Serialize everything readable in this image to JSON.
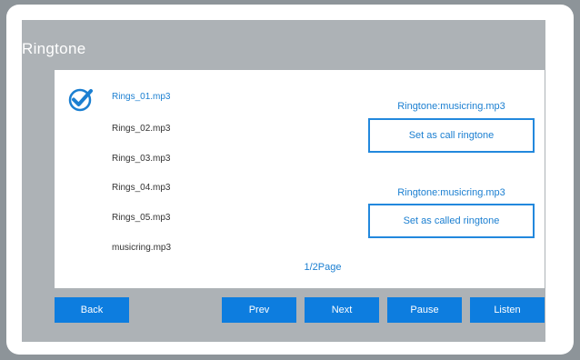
{
  "title": "Ringtone",
  "files": [
    {
      "name": "Rings_01.mp3",
      "selected": true
    },
    {
      "name": "Rings_02.mp3",
      "selected": false
    },
    {
      "name": "Rings_03.mp3",
      "selected": false
    },
    {
      "name": "Rings_04.mp3",
      "selected": false
    },
    {
      "name": "Rings_05.mp3",
      "selected": false
    },
    {
      "name": "musicring.mp3",
      "selected": false
    }
  ],
  "call_ringtone": {
    "label": "Ringtone:musicring.mp3",
    "button": "Set as call ringtone"
  },
  "called_ringtone": {
    "label": "Ringtone:musicring.mp3",
    "button": "Set as called ringtone"
  },
  "pagination": "1/2Page",
  "buttons": {
    "back": "Back",
    "prev": "Prev",
    "next": "Next",
    "pause": "Pause",
    "listen": "Listen"
  },
  "colors": {
    "accent": "#1b7fd1",
    "button_bg": "#0d7ddf",
    "frame_bg": "#adb2b6"
  },
  "icons": {
    "selected": "check-circle-icon"
  }
}
